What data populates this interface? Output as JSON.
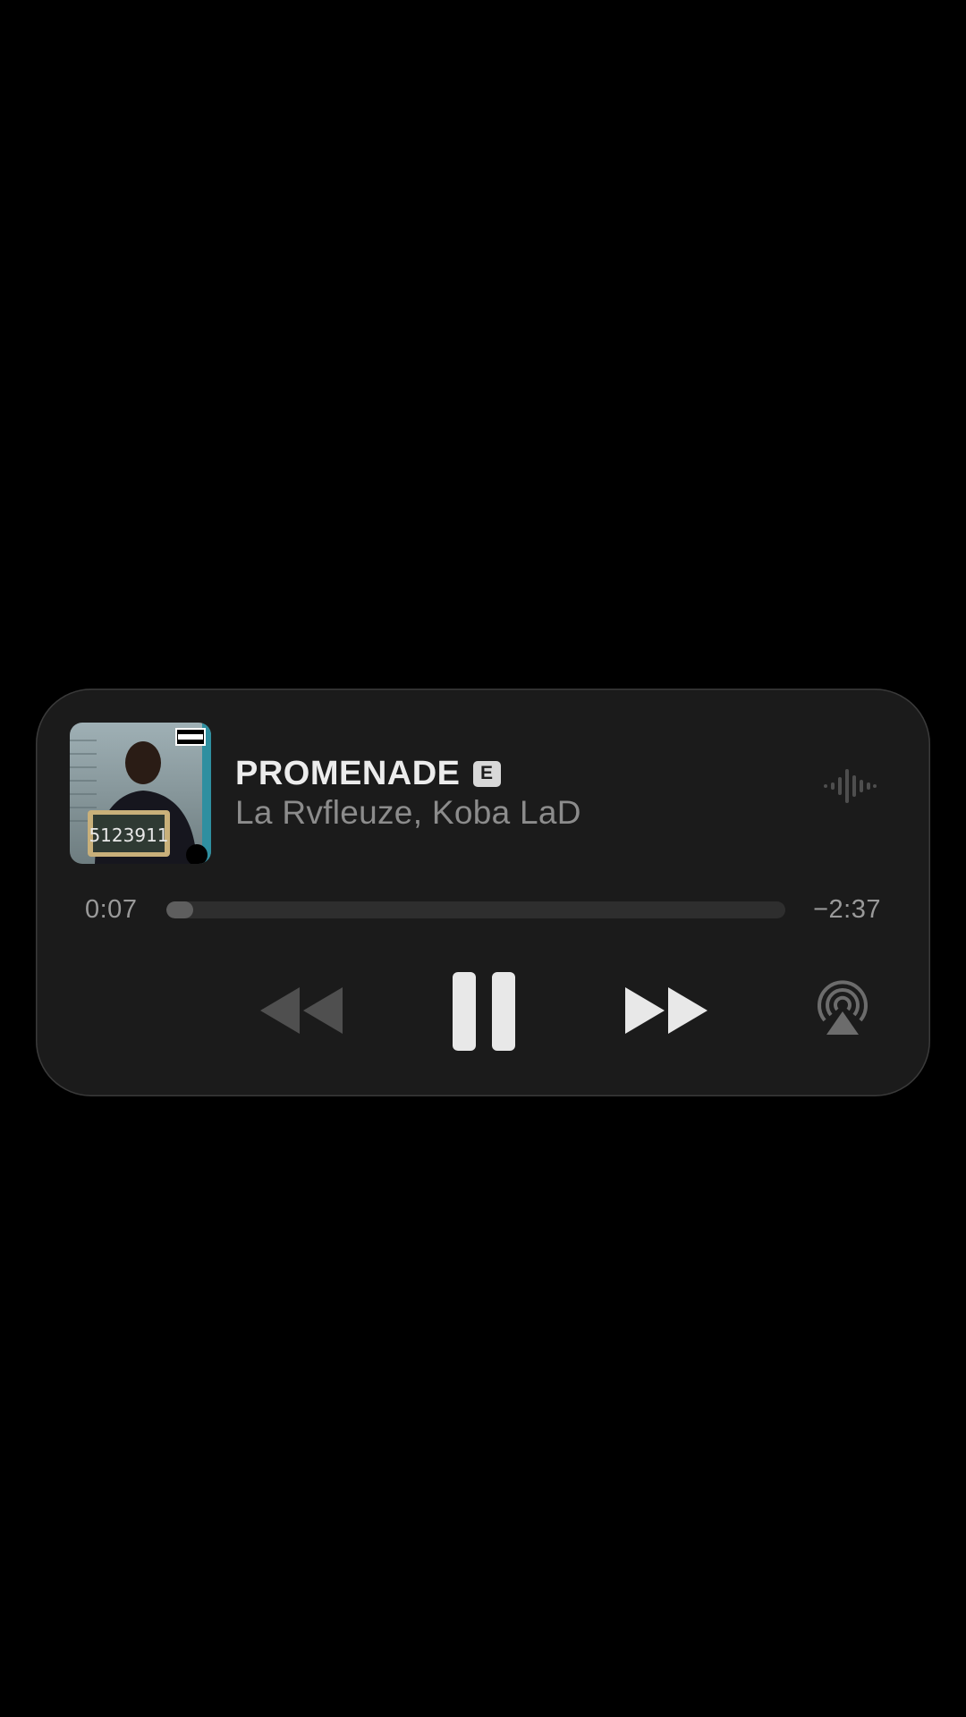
{
  "now_playing": {
    "title": "PROMENADE",
    "explicit_badge": "E",
    "artist": "La Rvfleuze, Koba LaD",
    "artwork": {
      "icon": "album-artwork",
      "sign_text": "5123911",
      "advisory_text": "PARENTAL ADVISORY"
    }
  },
  "progress": {
    "elapsed": "0:07",
    "remaining": "−2:37",
    "fraction": 0.043
  },
  "controls": {
    "rewind_icon": "rewind-icon",
    "pause_icon": "pause-icon",
    "forward_icon": "fast-forward-icon",
    "airplay_icon": "airplay-icon",
    "waveform_icon": "waveform-icon"
  },
  "colors": {
    "background": "#000000",
    "card": "#1b1b1b",
    "title": "#ececec",
    "subtitle": "#8c8c8c",
    "disabled_control": "#555555",
    "active_control": "#e8e8e8"
  }
}
